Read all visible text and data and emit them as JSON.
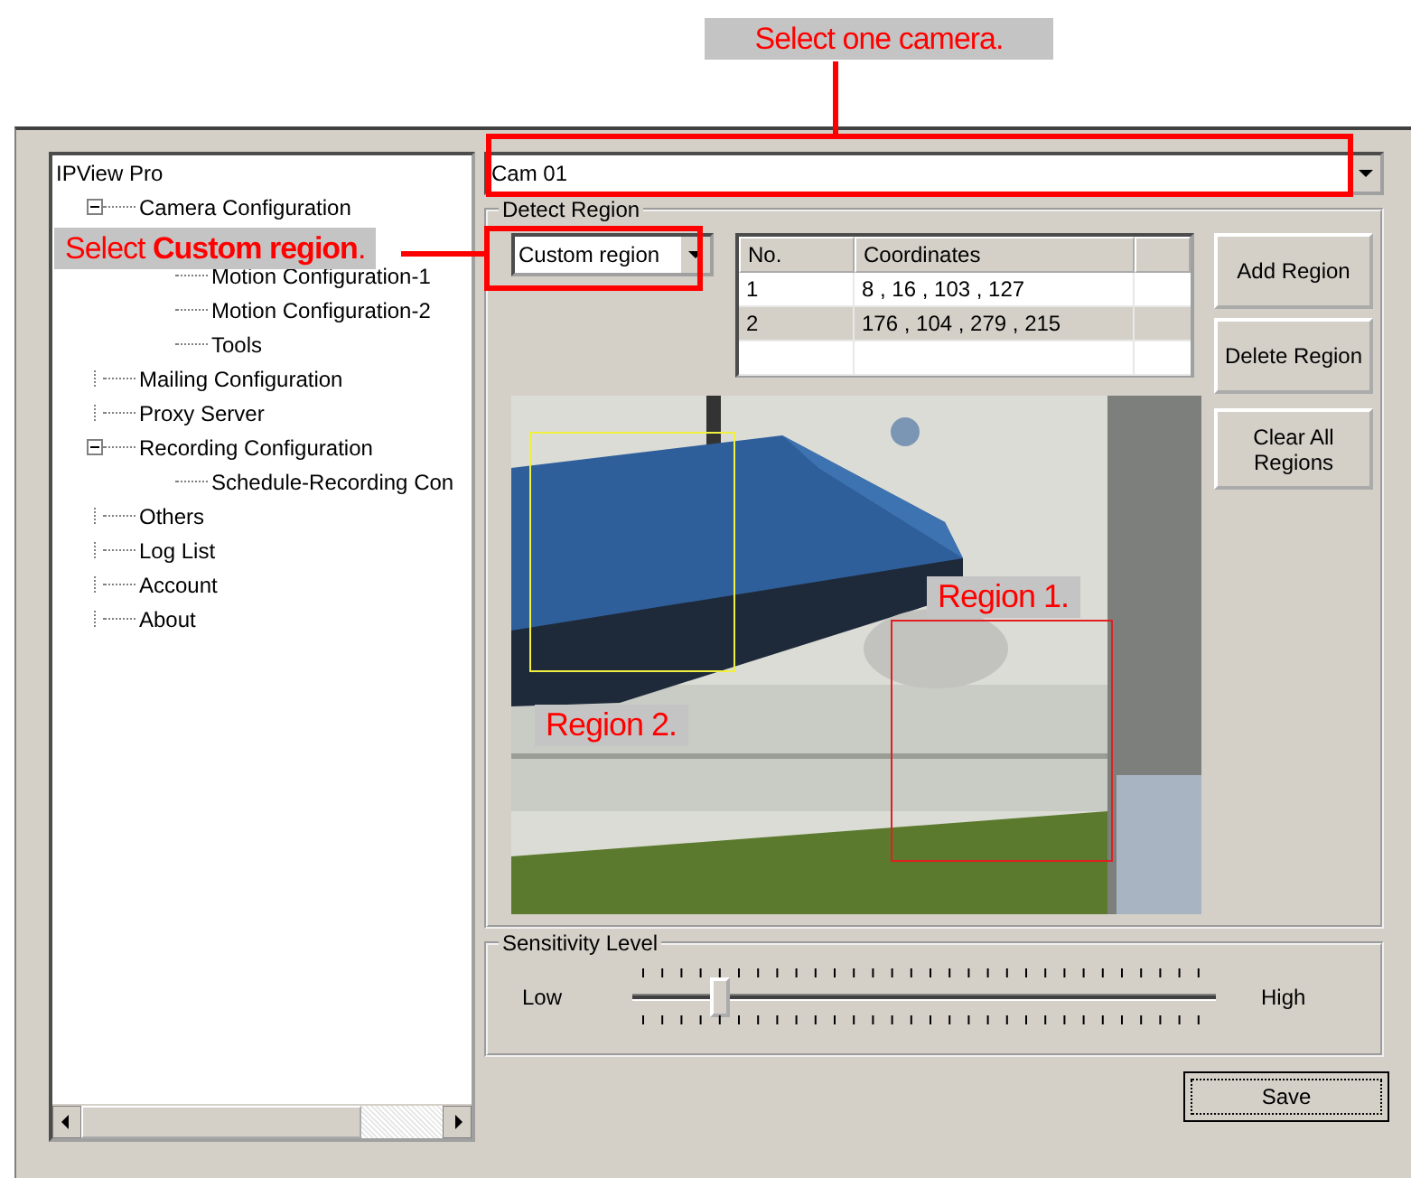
{
  "callouts": {
    "camera": "Select one camera.",
    "mode": "Select **Custom region**."
  },
  "tree": {
    "root": "IPView Pro",
    "items": [
      {
        "label": "Camera Configuration",
        "expanded": true,
        "children": [
          {
            "label": "Motion Configuration-1"
          },
          {
            "label": "Motion Configuration-2"
          },
          {
            "label": "Tools"
          }
        ]
      },
      {
        "label": "Mailing Configuration"
      },
      {
        "label": "Proxy Server"
      },
      {
        "label": "Recording Configuration",
        "expanded": true,
        "children": [
          {
            "label": "Schedule-Recording Con"
          }
        ]
      },
      {
        "label": "Others"
      },
      {
        "label": "Log List"
      },
      {
        "label": "Account"
      },
      {
        "label": "About"
      }
    ]
  },
  "camera_select": {
    "value": "Cam 01"
  },
  "detect_region": {
    "legend": "Detect Region",
    "mode": "Custom region",
    "table": {
      "columns": [
        "No.",
        "Coordinates"
      ],
      "rows": [
        {
          "cells": [
            "1",
            "8 , 16 , 103 , 127"
          ],
          "selected": false,
          "color": "#f0f040"
        },
        {
          "cells": [
            "2",
            "176 , 104 , 279 , 215"
          ],
          "selected": true,
          "color": "#e02020"
        }
      ]
    },
    "buttons": [
      "Add Region",
      "Delete Region",
      "Clear All Regions"
    ],
    "picture_labels": [
      "Region 1.",
      "Region 2."
    ]
  },
  "sensitivity": {
    "legend": "Sensitivity Level",
    "low": "Low",
    "high": "High",
    "level": 0.15
  },
  "save_button": "Save"
}
